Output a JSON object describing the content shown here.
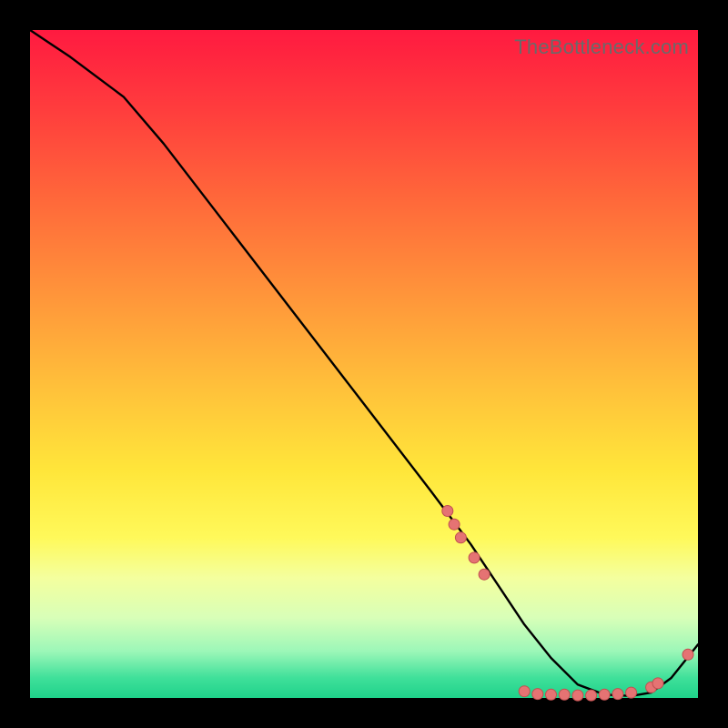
{
  "watermark": "TheBottleneck.com",
  "colors": {
    "page_bg": "#000000",
    "curve": "#000000",
    "dot_fill": "#e57373",
    "dot_stroke": "#c05050"
  },
  "chart_data": {
    "type": "line",
    "title": "",
    "xlabel": "",
    "ylabel": "",
    "xlim": [
      0,
      100
    ],
    "ylim": [
      0,
      100
    ],
    "series": [
      {
        "name": "curve",
        "x": [
          0,
          3,
          6,
          10,
          14,
          20,
          30,
          40,
          50,
          60,
          66,
          70,
          74,
          78,
          82,
          86,
          90,
          93,
          96,
          100
        ],
        "y": [
          100,
          98,
          96,
          93,
          90,
          83,
          70,
          57,
          44,
          31,
          23,
          17,
          11,
          6,
          2,
          0.5,
          0.3,
          0.8,
          3,
          8
        ]
      }
    ],
    "markers": [
      {
        "x": 62.5,
        "y": 28.0
      },
      {
        "x": 63.5,
        "y": 26.0
      },
      {
        "x": 64.5,
        "y": 24.0
      },
      {
        "x": 66.5,
        "y": 21.0
      },
      {
        "x": 68.0,
        "y": 18.5
      },
      {
        "x": 74.0,
        "y": 1.0
      },
      {
        "x": 76.0,
        "y": 0.6
      },
      {
        "x": 78.0,
        "y": 0.5
      },
      {
        "x": 80.0,
        "y": 0.5
      },
      {
        "x": 82.0,
        "y": 0.4
      },
      {
        "x": 84.0,
        "y": 0.4
      },
      {
        "x": 86.0,
        "y": 0.5
      },
      {
        "x": 88.0,
        "y": 0.6
      },
      {
        "x": 90.0,
        "y": 0.8
      },
      {
        "x": 93.0,
        "y": 1.6
      },
      {
        "x": 94.0,
        "y": 2.2
      },
      {
        "x": 98.5,
        "y": 6.5
      }
    ]
  }
}
